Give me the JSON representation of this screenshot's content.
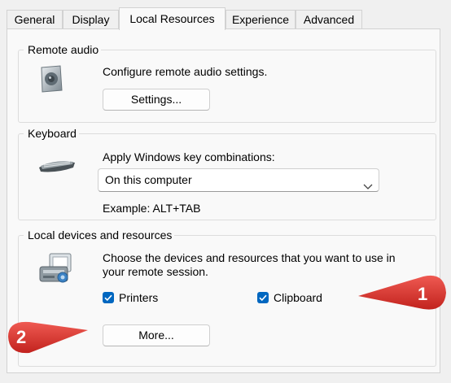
{
  "tabs": [
    {
      "label": "General"
    },
    {
      "label": "Display"
    },
    {
      "label": "Local Resources",
      "active": true
    },
    {
      "label": "Experience"
    },
    {
      "label": "Advanced"
    }
  ],
  "remote_audio": {
    "legend": "Remote audio",
    "description": "Configure remote audio settings.",
    "settings_button": "Settings..."
  },
  "keyboard": {
    "legend": "Keyboard",
    "description": "Apply Windows key combinations:",
    "selected_option": "On this computer",
    "example": "Example: ALT+TAB"
  },
  "local_devices": {
    "legend": "Local devices and resources",
    "description_line1": "Choose the devices and resources that you want to use in",
    "description_line2": "your remote session.",
    "printers_label": "Printers",
    "printers_checked": true,
    "clipboard_label": "Clipboard",
    "clipboard_checked": true,
    "more_button": "More..."
  },
  "annotations": {
    "callout_1": "1",
    "callout_2": "2",
    "color": "#d9302c"
  },
  "colors": {
    "checkbox_accent": "#0067c0"
  }
}
